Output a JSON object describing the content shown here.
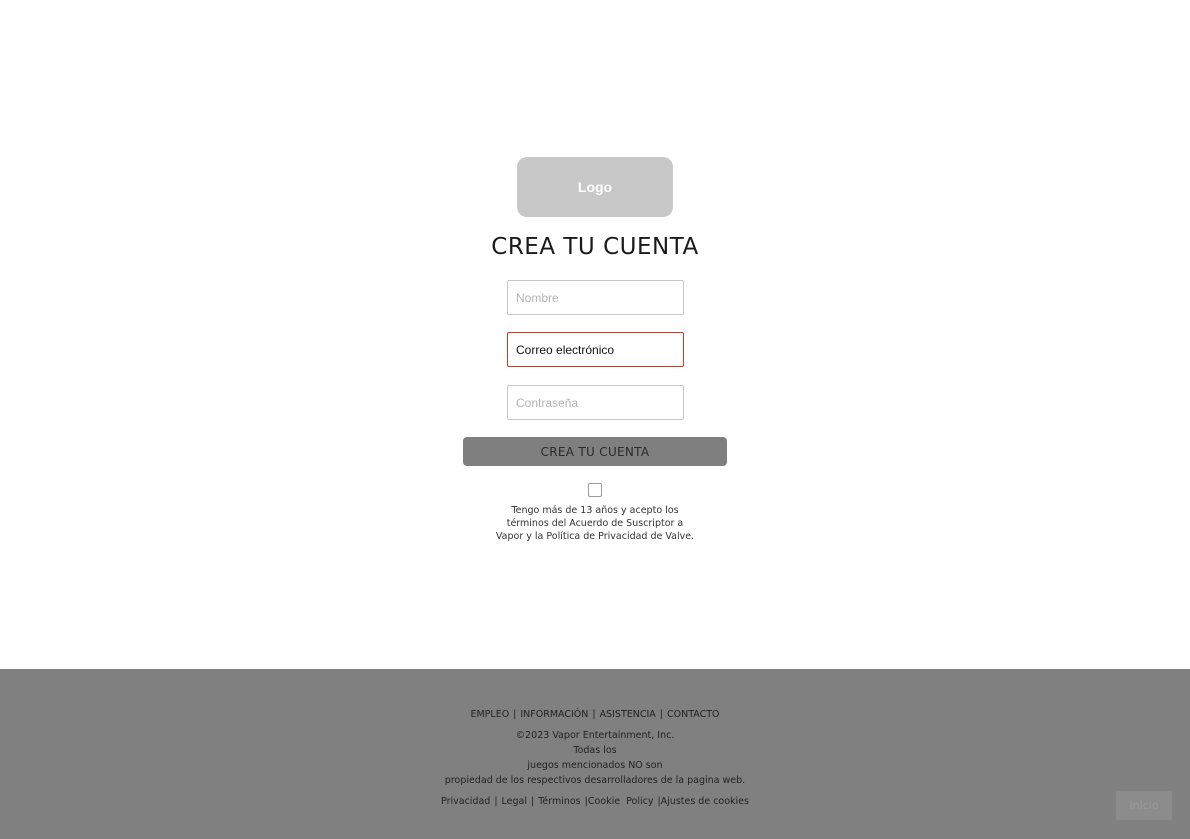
{
  "logo": {
    "label": "Logo"
  },
  "title": "CREA TU CUENTA",
  "form": {
    "name_placeholder": "Nombre",
    "email_value": "Correo electrónico",
    "password_placeholder": "Contraseña",
    "submit_label": "CREA TU CUENTA",
    "terms_lines": [
      "Tengo más de 13 años y acepto los",
      "términos del Acuerdo de Suscriptor a",
      "Vapor y la Política de Privacidad de Valve."
    ]
  },
  "colors": {
    "footer_bg": "#808080",
    "error_border": "#e0321e",
    "submit_bg": "#7f7f7f",
    "logo_bg": "#c8c8c8"
  },
  "footer": {
    "nav_links": [
      "EMPLEO",
      "INFORMACIÓN",
      "ASISTENCIA",
      "CONTACTO"
    ],
    "nav_separator": "|",
    "copyright": "©2023 Vapor Entertainment, Inc.",
    "line2": "Todas los",
    "line3": "juegos mencionados NO son",
    "line4": "propiedad de los respectivos desarrolladores de la pagina web.",
    "legal_links": [
      "Privacidad",
      "Legal",
      "Términos",
      "Cookie  Policy",
      "Ajustes de cookies"
    ],
    "corner_button": "Inicio"
  }
}
